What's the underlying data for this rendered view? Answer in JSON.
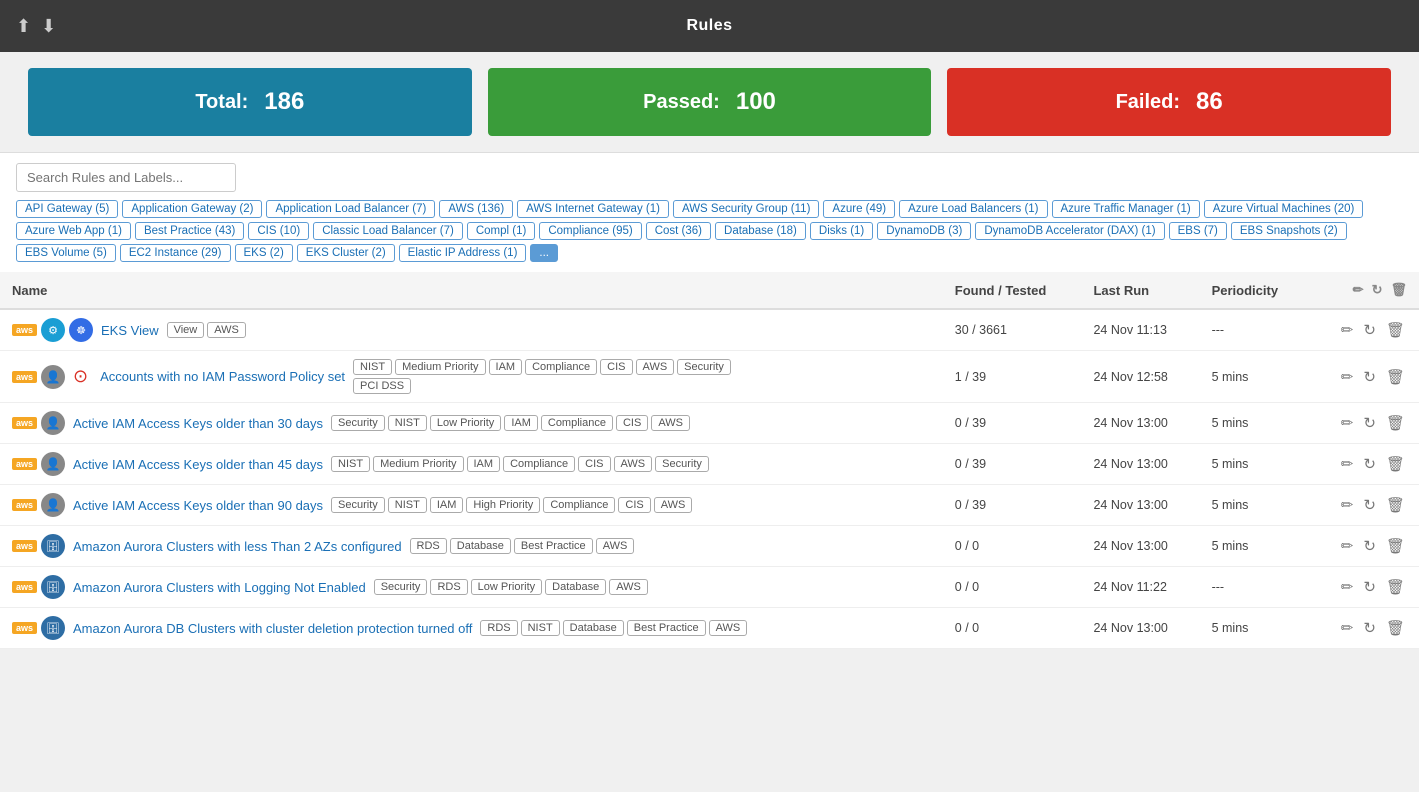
{
  "header": {
    "title": "Rules",
    "icon_upload": "⬆",
    "icon_download": "⬇"
  },
  "stats": {
    "total_label": "Total:",
    "total_value": "186",
    "passed_label": "Passed:",
    "passed_value": "100",
    "failed_label": "Failed:",
    "failed_value": "86"
  },
  "search": {
    "placeholder": "Search Rules and Labels..."
  },
  "tags": [
    "API Gateway (5)",
    "Application Gateway (2)",
    "Application Load Balancer (7)",
    "AWS (136)",
    "AWS Internet Gateway (1)",
    "AWS Security Group (11)",
    "Azure (49)",
    "Azure Load Balancers (1)",
    "Azure Traffic Manager (1)",
    "Azure Virtual Machines (20)",
    "Azure Web App (1)",
    "Best Practice (43)",
    "CIS (10)",
    "Classic Load Balancer (7)",
    "Compl (1)",
    "Compliance (95)",
    "Cost (36)",
    "Database (18)",
    "Disks (1)",
    "DynamoDB (3)",
    "DynamoDB Accelerator (DAX) (1)",
    "EBS (7)",
    "EBS Snapshots (2)",
    "EBS Volume (5)",
    "EC2 Instance (29)",
    "EKS (2)",
    "EKS Cluster (2)",
    "Elastic IP Address (1)",
    "..."
  ],
  "table": {
    "columns": [
      "Name",
      "Found / Tested",
      "Last Run",
      "Periodicity"
    ],
    "rows": [
      {
        "name": "EKS View",
        "provider": "aws",
        "icon_type": "eks",
        "tags": [
          "View",
          "AWS"
        ],
        "found": "30 / 3661",
        "last_run": "24 Nov 11:13",
        "periodicity": "---",
        "has_alert": false
      },
      {
        "name": "Accounts with no IAM Password Policy set",
        "provider": "aws",
        "icon_type": "user",
        "tags": [
          "NIST",
          "Medium Priority",
          "IAM",
          "Compliance",
          "CIS",
          "AWS",
          "Security",
          "PCI DSS"
        ],
        "found": "1 / 39",
        "last_run": "24 Nov 12:58",
        "periodicity": "5 mins",
        "has_alert": true
      },
      {
        "name": "Active IAM Access Keys older than 30 days",
        "provider": "aws",
        "icon_type": "user",
        "tags": [
          "Security",
          "NIST",
          "Low Priority",
          "IAM",
          "Compliance",
          "CIS",
          "AWS"
        ],
        "found": "0 / 39",
        "last_run": "24 Nov 13:00",
        "periodicity": "5 mins",
        "has_alert": false
      },
      {
        "name": "Active IAM Access Keys older than 45 days",
        "provider": "aws",
        "icon_type": "user",
        "tags": [
          "NIST",
          "Medium Priority",
          "IAM",
          "Compliance",
          "CIS",
          "AWS",
          "Security"
        ],
        "found": "0 / 39",
        "last_run": "24 Nov 13:00",
        "periodicity": "5 mins",
        "has_alert": false
      },
      {
        "name": "Active IAM Access Keys older than 90 days",
        "provider": "aws",
        "icon_type": "user",
        "tags": [
          "Security",
          "NIST",
          "IAM",
          "High Priority",
          "Compliance",
          "CIS",
          "AWS"
        ],
        "found": "0 / 39",
        "last_run": "24 Nov 13:00",
        "periodicity": "5 mins",
        "has_alert": false
      },
      {
        "name": "Amazon Aurora Clusters with less Than 2 AZs configured",
        "provider": "aws",
        "icon_type": "db",
        "tags": [
          "RDS",
          "Database",
          "Best Practice",
          "AWS"
        ],
        "found": "0 / 0",
        "last_run": "24 Nov 13:00",
        "periodicity": "5 mins",
        "has_alert": false
      },
      {
        "name": "Amazon Aurora Clusters with Logging Not Enabled",
        "provider": "aws",
        "icon_type": "db",
        "tags": [
          "Security",
          "RDS",
          "Low Priority",
          "Database",
          "AWS"
        ],
        "found": "0 / 0",
        "last_run": "24 Nov 11:22",
        "periodicity": "---",
        "has_alert": false
      },
      {
        "name": "Amazon Aurora DB Clusters with cluster deletion protection turned off",
        "provider": "aws",
        "icon_type": "db",
        "tags": [
          "RDS",
          "NIST",
          "Database",
          "Best Practice",
          "AWS"
        ],
        "found": "0 / 0",
        "last_run": "24 Nov 13:00",
        "periodicity": "5 mins",
        "has_alert": false
      }
    ]
  }
}
